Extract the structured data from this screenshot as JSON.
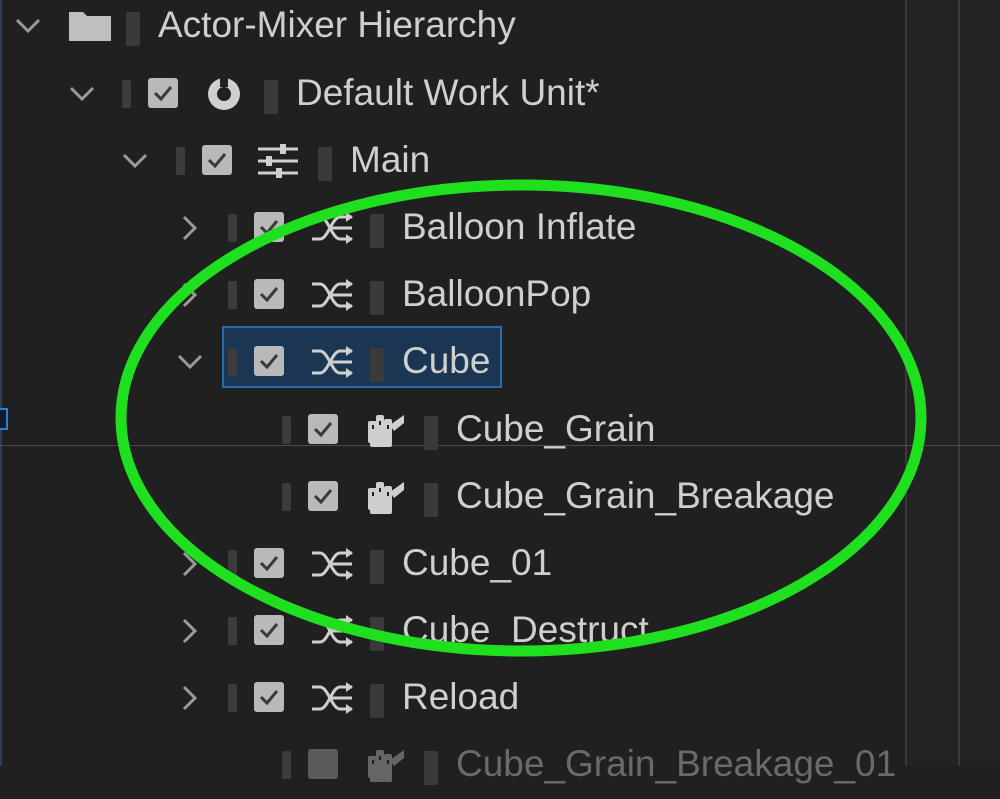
{
  "tree": {
    "root": {
      "label": "Actor-Mixer Hierarchy",
      "icon": "folder-icon",
      "expanded": true
    },
    "work_unit": {
      "label": "Default Work Unit*",
      "icon": "work-unit-icon",
      "expanded": true
    },
    "main": {
      "label": "Main",
      "icon": "actor-mixer-icon",
      "expanded": true
    },
    "items": [
      {
        "label": "Balloon Inflate",
        "icon": "random-container-icon",
        "expanded": false
      },
      {
        "label": "BalloonPop",
        "icon": "random-container-icon",
        "expanded": false
      },
      {
        "label": "Cube",
        "icon": "random-container-icon",
        "expanded": true,
        "selected": true
      },
      {
        "label": "Cube_Grain",
        "icon": "sound-sfx-icon"
      },
      {
        "label": "Cube_Grain_Breakage",
        "icon": "sound-sfx-icon"
      },
      {
        "label": "Cube_01",
        "icon": "random-container-icon",
        "expanded": false
      },
      {
        "label": "Cube_Destruct",
        "icon": "random-container-icon",
        "expanded": false
      },
      {
        "label": "Reload",
        "icon": "random-container-icon",
        "expanded": false
      },
      {
        "label": "Cube_Grain_Breakage_01",
        "icon": "sound-sfx-icon",
        "disabled": true
      }
    ]
  },
  "annotation": {
    "color": "#1fe01f",
    "shape": "ellipse"
  },
  "colors": {
    "background": "#202020",
    "text": "#cfcfcf",
    "selection": "#1b3653",
    "selection_border": "#2a6aa8"
  }
}
